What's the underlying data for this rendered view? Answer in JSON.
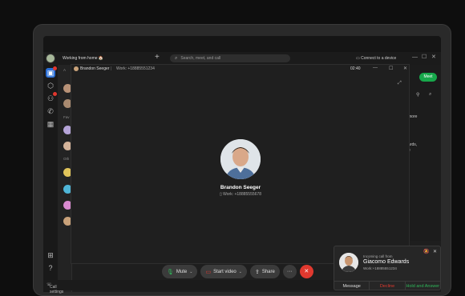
{
  "titlebar": {
    "status": "Working from home 🏠",
    "search_placeholder": "Search, meet, and call",
    "connect_label": "Connect to a device",
    "window_controls": [
      "—",
      "☐",
      "✕"
    ]
  },
  "rail": {
    "help_label": "Help"
  },
  "right_panel": {
    "meet_label": "Meet",
    "text1": "more",
    "text2": "ards,",
    "text3": "e"
  },
  "call_window": {
    "header_name": "Brandon Seeger",
    "header_work": "Work: +18885551234",
    "timer": "02:40",
    "caller_name": "Brandon Seeger",
    "caller_work": "Work: +18885555678"
  },
  "call_controls": {
    "mute_label": "Mute",
    "video_label": "Start video",
    "share_label": "Share",
    "more_icon": "more-icon",
    "hangup_icon": "hangup-icon"
  },
  "bottom": {
    "call_settings_label": "Call settings"
  },
  "toast": {
    "from_label": "Incoming call from",
    "caller_name": "Giacomo Edwards",
    "caller_work": "Work:+18885551234",
    "message_label": "Message",
    "decline_label": "Decline",
    "hold_answer_label": "Hold and Answer"
  },
  "colors": {
    "accent_green": "#17a84b",
    "decline_red": "#e0392f",
    "hold_answer_green": "#2fb85a"
  }
}
